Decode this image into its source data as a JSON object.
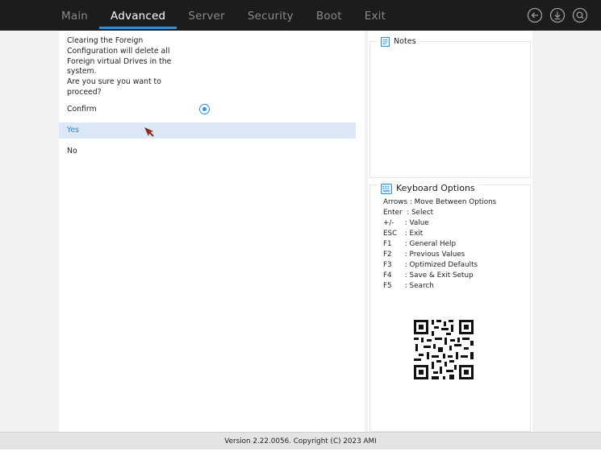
{
  "header": {
    "tabs": [
      {
        "label": "Main",
        "active": false
      },
      {
        "label": "Advanced",
        "active": true
      },
      {
        "label": "Server",
        "active": false
      },
      {
        "label": "Security",
        "active": false
      },
      {
        "label": "Boot",
        "active": false
      },
      {
        "label": "Exit",
        "active": false
      }
    ],
    "icons": [
      "back-icon",
      "download-icon",
      "search-icon"
    ]
  },
  "dialog": {
    "message": "Clearing the Foreign Configuration will delete all Foreign virtual Drives in the system.\nAre you sure you want to proceed?",
    "confirm_label": "Confirm",
    "confirm_checked": true,
    "options": [
      {
        "label": "Yes",
        "selected": true
      },
      {
        "label": "No",
        "selected": false
      }
    ]
  },
  "notes": {
    "title": "Notes"
  },
  "keyboard": {
    "title": "Keyboard Options",
    "items": [
      {
        "key": "Arrows",
        "desc": " : Move Between Options"
      },
      {
        "key": "Enter",
        "desc": "  : Select"
      },
      {
        "key": "+/-",
        "desc": " : Value"
      },
      {
        "key": "ESC",
        "desc": " : Exit"
      },
      {
        "key": "F1",
        "desc": " : General Help"
      },
      {
        "key": "F2",
        "desc": " : Previous Values"
      },
      {
        "key": "F3",
        "desc": " : Optimized Defaults"
      },
      {
        "key": "F4",
        "desc": " : Save & Exit Setup"
      },
      {
        "key": "F5",
        "desc": " : Search"
      }
    ]
  },
  "footer": {
    "text": "Version 2.22.0056. Copyright (C) 2023 AMI"
  },
  "colors": {
    "accent": "#2f8fe0",
    "topbar": "#1c1c1c",
    "selected_row": "#dce8f5",
    "cursor": "#8b2a1e"
  }
}
